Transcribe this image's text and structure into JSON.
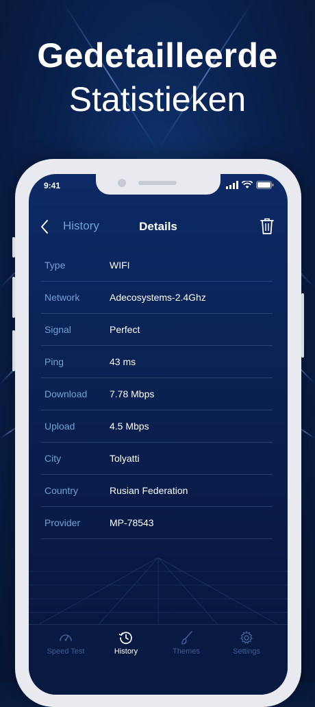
{
  "headline": {
    "line1": "Gedetailleerde",
    "line2": "Statistieken"
  },
  "status_bar": {
    "time": "9:41"
  },
  "nav": {
    "back_label": "History",
    "title": "Details"
  },
  "details": [
    {
      "label": "Type",
      "value": "WIFI"
    },
    {
      "label": "Network",
      "value": "Adecosystems-2.4Ghz"
    },
    {
      "label": "Signal",
      "value": "Perfect"
    },
    {
      "label": "Ping",
      "value": "43 ms"
    },
    {
      "label": "Download",
      "value": "7.78 Mbps"
    },
    {
      "label": "Upload",
      "value": "4.5 Mbps"
    },
    {
      "label": "City",
      "value": "Tolyatti"
    },
    {
      "label": "Country",
      "value": "Rusian Federation"
    },
    {
      "label": "Provider",
      "value": "MP-78543"
    }
  ],
  "tabs": [
    {
      "label": "Speed Test",
      "icon": "speedometer-icon",
      "active": false
    },
    {
      "label": "History",
      "icon": "history-icon",
      "active": true
    },
    {
      "label": "Themes",
      "icon": "paintbrush-icon",
      "active": false
    },
    {
      "label": "Settings",
      "icon": "gear-icon",
      "active": false
    }
  ],
  "colors": {
    "accent": "#6fa3d6",
    "background": "#0a2152",
    "inactive_tab": "#3b5f97"
  }
}
